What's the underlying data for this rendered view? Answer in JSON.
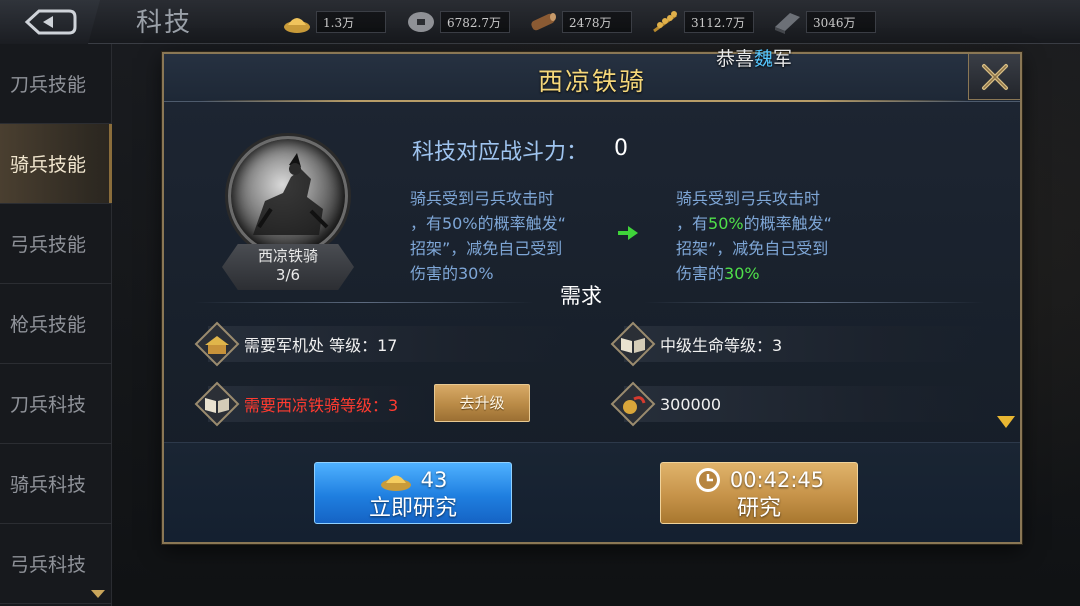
{
  "header": {
    "title": "科技",
    "resources": [
      {
        "icon": "gold-ingot-icon",
        "value": "1.3万"
      },
      {
        "icon": "coin-icon",
        "value": "6782.7万"
      },
      {
        "icon": "wood-icon",
        "value": "2478万"
      },
      {
        "icon": "grain-icon",
        "value": "3112.7万"
      },
      {
        "icon": "iron-icon",
        "value": "3046万"
      }
    ]
  },
  "sidebar": {
    "items": [
      {
        "label": "刀兵技能",
        "active": false
      },
      {
        "label": "骑兵技能",
        "active": true
      },
      {
        "label": "弓兵技能",
        "active": false
      },
      {
        "label": "枪兵技能",
        "active": false
      },
      {
        "label": "刀兵科技",
        "active": false
      },
      {
        "label": "骑兵科技",
        "active": false
      },
      {
        "label": "弓兵科技",
        "active": false
      }
    ]
  },
  "congrats": {
    "prefix": "恭喜",
    "highlight": "魏",
    "suffix": "军"
  },
  "modal": {
    "title": "西凉铁骑",
    "skill_name": "西凉铁骑",
    "skill_level": "3/6",
    "power_label": "科技对应战斗力：",
    "power_value": "0",
    "current_desc": {
      "line1": "骑兵受到弓兵攻击时",
      "line2_pre": "，有50%的概率触发“",
      "line3": "招架”，减免自己受到",
      "line4_pre": "伤害的30%"
    },
    "next_desc": {
      "line1": "骑兵受到弓兵攻击时",
      "line2_pre": "，有",
      "line2_pct": "50%",
      "line2_post": "的概率触发“",
      "line3": "招架”，减免自己受到",
      "line4_pre": "伤害的",
      "line4_pct": "30%"
    },
    "requirements_title": "需求",
    "requirements": [
      {
        "icon": "military-office-icon",
        "text": "需要军机处 等级：17",
        "met": true
      },
      {
        "icon": "book-icon",
        "text": "中级生命等级：3",
        "met": true
      },
      {
        "icon": "book-icon",
        "text": "需要西凉铁骑等级：3",
        "met": false
      },
      {
        "icon": "coin-bag-icon",
        "text": "300000",
        "met": true
      }
    ],
    "upgrade_label": "去升级",
    "instant_cost": "43",
    "instant_label": "立即研究",
    "timer": "00:42:45",
    "research_label": "研究"
  },
  "colors": {
    "accent_gold": "#f5d77a",
    "desc_blue": "#7ea6d6",
    "highlight_green": "#4fe04a",
    "unmet_red": "#ff3b30"
  }
}
